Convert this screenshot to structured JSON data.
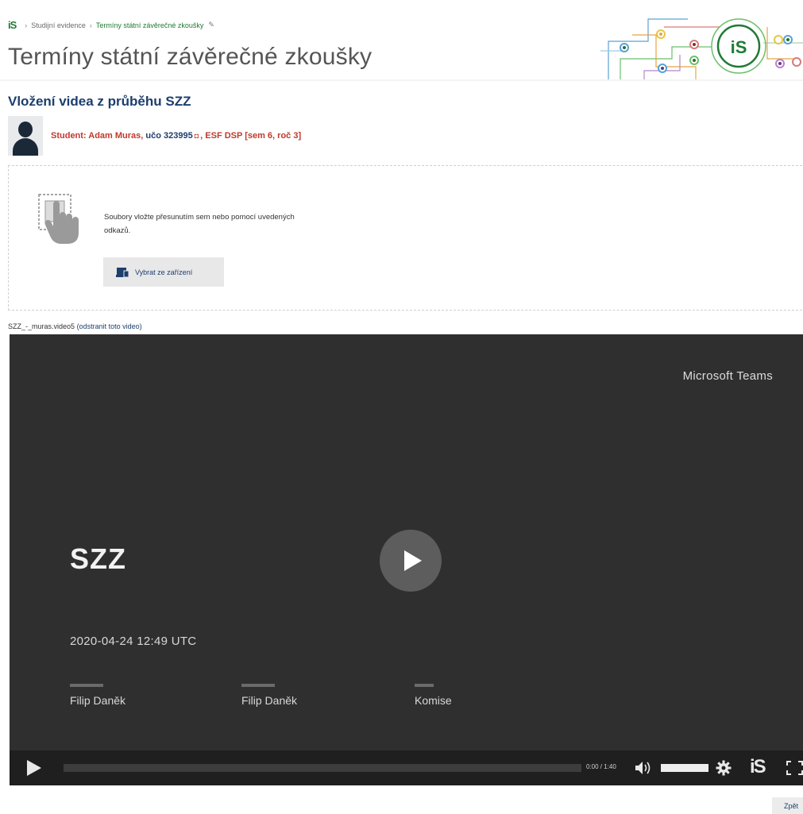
{
  "breadcrumb": {
    "logo": "iS",
    "items": [
      "Studijní evidence",
      "Termíny státní závěrečné zkoušky"
    ]
  },
  "page": {
    "title": "Termíny státní závěrečné zkoušky",
    "section_heading": "Vložení videa z průběhu SZZ"
  },
  "student": {
    "label": "Student: Adam Muras,",
    "uco": "učo 323995",
    "uco_icon": "◘",
    "program": ", ESF DSP [sem 6, roč 3]"
  },
  "upload": {
    "instruction": "Soubory vložte přesunutím sem nebo pomocí uvedených odkazů.",
    "select_device_label": "Vybrat ze zařízení"
  },
  "file": {
    "name": "SZZ_-_muras.video5",
    "remove_link": "(odstranit toto video)"
  },
  "video": {
    "brand": "Microsoft Teams",
    "title": "SZZ",
    "date": "2020-04-24 12:49 UTC",
    "people": [
      {
        "name": "Filip Daněk"
      },
      {
        "name": "Filip Daněk"
      },
      {
        "name": "Komise"
      }
    ],
    "time": "0:00 / 1:40",
    "progress": 0,
    "volume": 1.0,
    "logo": "iS"
  },
  "footer": {
    "back_label": "Zpět"
  },
  "colors": {
    "accent_green": "#1f7a34",
    "link_blue": "#1d3e6e",
    "student_red": "#c0392b",
    "video_bg": "#2f2f2f"
  }
}
